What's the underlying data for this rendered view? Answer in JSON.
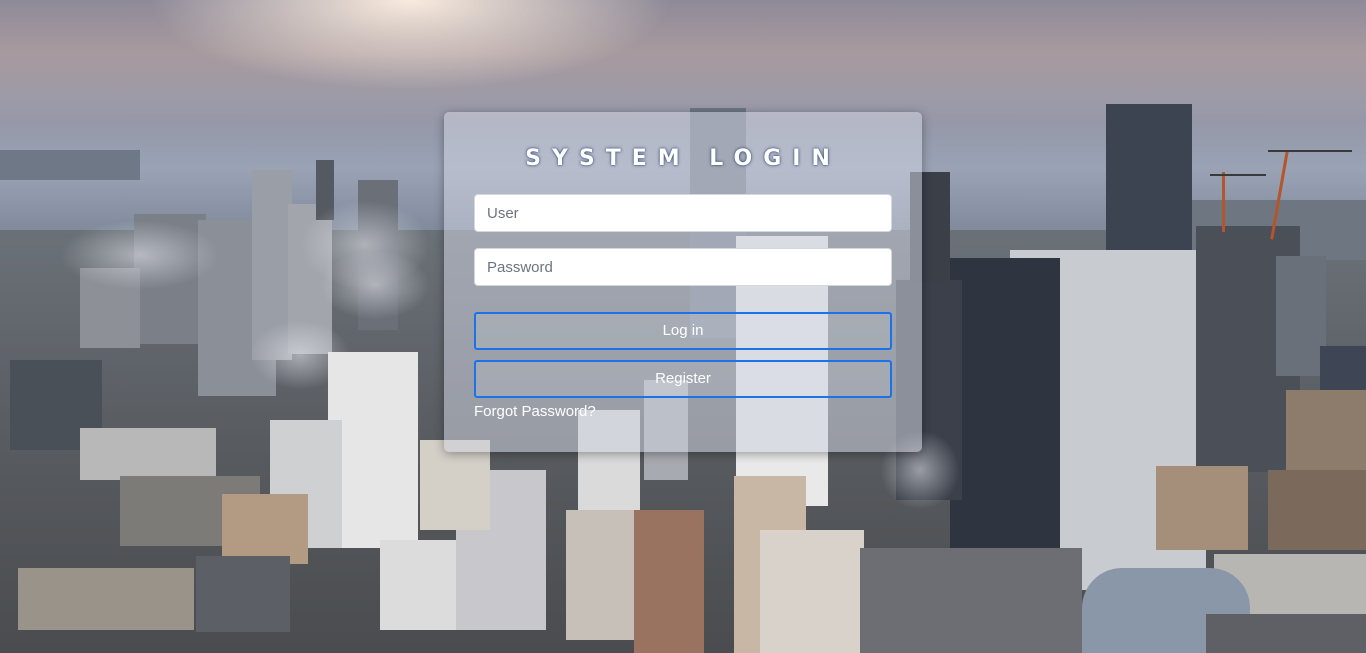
{
  "login": {
    "title": "SYSTEM LOGIN",
    "user_placeholder": "User",
    "password_placeholder": "Password",
    "login_label": "Log in",
    "register_label": "Register",
    "forgot_label": "Forgot Password?"
  },
  "colors": {
    "button_border": "#1a73e8",
    "panel_bg": "rgba(205,210,222,0.55)",
    "title_text": "#ffffff"
  }
}
